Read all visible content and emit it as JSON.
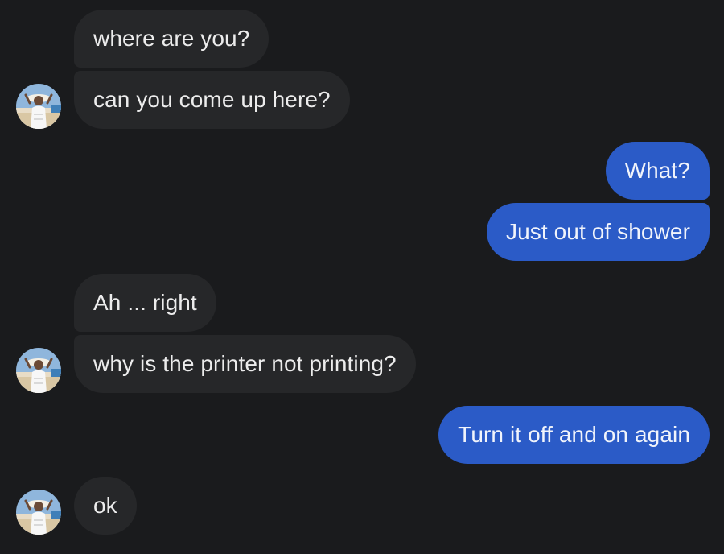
{
  "messages": [
    {
      "from": "them",
      "text": "where are you?"
    },
    {
      "from": "them",
      "text": "can you come up here?"
    },
    {
      "from": "me",
      "text": "What?"
    },
    {
      "from": "me",
      "text": "Just out of shower"
    },
    {
      "from": "them",
      "text": "Ah ... right"
    },
    {
      "from": "them",
      "text": "why is the printer not printing?"
    },
    {
      "from": "me",
      "text": "Turn it off and on again"
    },
    {
      "from": "them",
      "text": "ok"
    }
  ],
  "colors": {
    "background": "#1a1b1d",
    "incoming_bubble": "#262729",
    "outgoing_bubble": "#2b5bc7",
    "text": "#ececec"
  },
  "avatar": {
    "icon": "contact-avatar-photo"
  }
}
